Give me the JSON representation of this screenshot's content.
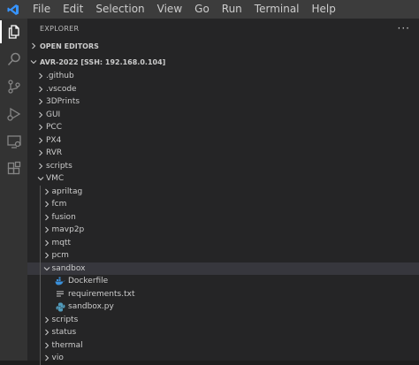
{
  "menu": [
    "File",
    "Edit",
    "Selection",
    "View",
    "Go",
    "Run",
    "Terminal",
    "Help"
  ],
  "activity": [
    "explorer-icon",
    "search-icon",
    "source-control-icon",
    "run-debug-icon",
    "remote-explorer-icon",
    "extensions-icon"
  ],
  "sidebar": {
    "title": "EXPLORER",
    "more": "···",
    "open_editors": "OPEN EDITORS",
    "workspace": "AVR-2022 [SSH: 192.168.0.104]"
  },
  "tree": [
    {
      "label": ".github",
      "depth": 0,
      "type": "folder",
      "open": false
    },
    {
      "label": ".vscode",
      "depth": 0,
      "type": "folder",
      "open": false
    },
    {
      "label": "3DPrints",
      "depth": 0,
      "type": "folder",
      "open": false
    },
    {
      "label": "GUI",
      "depth": 0,
      "type": "folder",
      "open": false
    },
    {
      "label": "PCC",
      "depth": 0,
      "type": "folder",
      "open": false
    },
    {
      "label": "PX4",
      "depth": 0,
      "type": "folder",
      "open": false
    },
    {
      "label": "RVR",
      "depth": 0,
      "type": "folder",
      "open": false
    },
    {
      "label": "scripts",
      "depth": 0,
      "type": "folder",
      "open": false
    },
    {
      "label": "VMC",
      "depth": 0,
      "type": "folder",
      "open": true
    },
    {
      "label": "apriltag",
      "depth": 1,
      "type": "folder",
      "open": false
    },
    {
      "label": "fcm",
      "depth": 1,
      "type": "folder",
      "open": false
    },
    {
      "label": "fusion",
      "depth": 1,
      "type": "folder",
      "open": false
    },
    {
      "label": "mavp2p",
      "depth": 1,
      "type": "folder",
      "open": false
    },
    {
      "label": "mqtt",
      "depth": 1,
      "type": "folder",
      "open": false
    },
    {
      "label": "pcm",
      "depth": 1,
      "type": "folder",
      "open": false
    },
    {
      "label": "sandbox",
      "depth": 1,
      "type": "folder",
      "open": true,
      "selected": true
    },
    {
      "label": "Dockerfile",
      "depth": 2,
      "type": "docker"
    },
    {
      "label": "requirements.txt",
      "depth": 2,
      "type": "text"
    },
    {
      "label": "sandbox.py",
      "depth": 2,
      "type": "python"
    },
    {
      "label": "scripts",
      "depth": 1,
      "type": "folder",
      "open": false
    },
    {
      "label": "status",
      "depth": 1,
      "type": "folder",
      "open": false
    },
    {
      "label": "thermal",
      "depth": 1,
      "type": "folder",
      "open": false
    },
    {
      "label": "vio",
      "depth": 1,
      "type": "folder",
      "open": false
    }
  ],
  "colors": {
    "accent_docker": "#3a8fd9",
    "accent_python": "#519aba",
    "selected_row": "#37373d"
  }
}
